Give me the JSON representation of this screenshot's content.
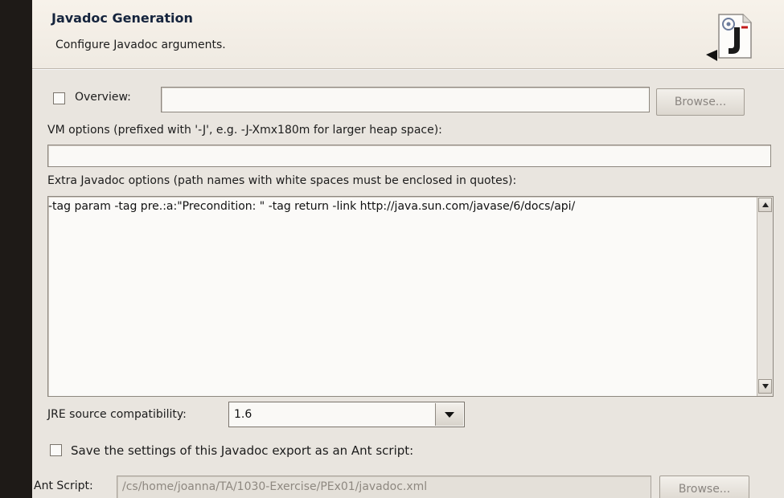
{
  "banner": {
    "title": "Javadoc Generation",
    "description": "Configure Javadoc arguments."
  },
  "overview": {
    "checkbox_label": "Overview:",
    "checked": false,
    "value": "",
    "browse_label": "Browse..."
  },
  "vm_options": {
    "label": "VM options (prefixed with '-J', e.g. -J-Xmx180m for larger heap space):",
    "value": ""
  },
  "extra_options": {
    "label": "Extra Javadoc options (path names with white spaces must be enclosed in quotes):",
    "value": "-tag param -tag pre.:a:\"Precondition: \" -tag return -link http://java.sun.com/javase/6/docs/api/"
  },
  "jre": {
    "label": "JRE source compatibility:",
    "selected": "1.6"
  },
  "save_settings": {
    "label": "Save the settings of this Javadoc export as an Ant script:",
    "checked": false
  },
  "ant_script": {
    "label": "Ant Script:",
    "value": "/cs/home/joanna/TA/1030-Exercise/PEx01/javadoc.xml",
    "browse_label": "Browse..."
  },
  "icons": {
    "banner": "javadoc-wizard-icon",
    "combo": "chevron-down-icon",
    "scroll_up": "arrow-up-icon",
    "scroll_down": "arrow-down-icon"
  },
  "colors": {
    "banner_title": "#15243d",
    "dialog_bg": "#e9e5df"
  }
}
